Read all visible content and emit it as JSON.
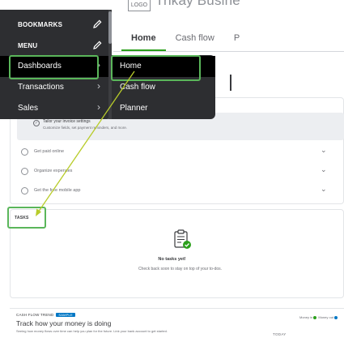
{
  "header": {
    "logo_text": "LOGO",
    "company_name": "Trikay Busine"
  },
  "tabs": [
    {
      "label": "Home",
      "active": true
    },
    {
      "label": "Cash flow",
      "active": false
    },
    {
      "label": "P",
      "active": false
    }
  ],
  "nav": {
    "bookmarks_label": "BOOKMARKS",
    "menu_label": "MENU",
    "items": [
      {
        "label": "Dashboards",
        "selected": true
      },
      {
        "label": "Transactions",
        "selected": false
      },
      {
        "label": "Sales",
        "selected": false
      }
    ],
    "submenu": [
      {
        "label": "Home",
        "selected": true
      },
      {
        "label": "Cash flow",
        "selected": false
      },
      {
        "label": "Planner",
        "selected": false
      }
    ]
  },
  "setup": {
    "first_title": "Tailor your invoice settings",
    "first_sub": "Customize fields, set payment reminders, and more.",
    "rows": [
      {
        "label": "Get paid online"
      },
      {
        "label": "Organize expenses"
      },
      {
        "label": "Get the free mobile app"
      }
    ]
  },
  "tasks": {
    "label": "TASKS",
    "empty_title": "No tasks yet!",
    "empty_sub": "Check back soon to stay on top of your to-dos."
  },
  "cash_flow": {
    "heading": "CASH FLOW TREND",
    "badge": "SAMPLE",
    "title": "Track how your money is doing",
    "sub": "Seeing how money flows over time can help you plan for the future. Link your bank account to get started.",
    "legend_in": "Money in",
    "legend_out": "Money out",
    "today": "TODAY"
  },
  "colors": {
    "nav_bg": "#2d2e31",
    "nav_selected": "#000000",
    "accent_green": "#2ca01c",
    "highlight_green": "#5ab65a",
    "arrow_yellow": "#b8cc2a",
    "badge_blue": "#0077c5"
  }
}
